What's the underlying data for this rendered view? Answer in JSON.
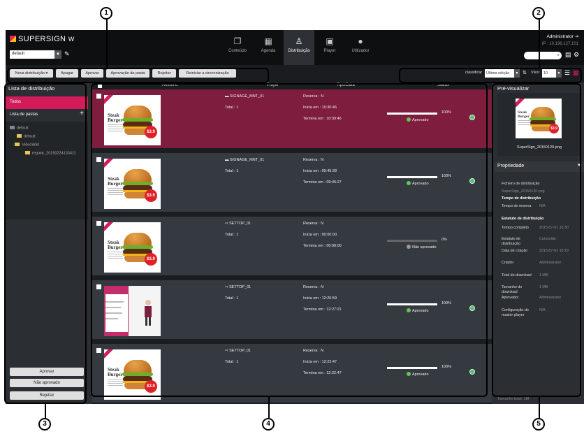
{
  "app": {
    "logo": "SUPERSIGN",
    "logo_suffix": "W",
    "group_select": "default",
    "admin_label": "Administrator",
    "ip": "IP : 10.196.127.101",
    "search_icon": "search-icon"
  },
  "nav": [
    {
      "label": "Conteúdo",
      "icon": "content-icon"
    },
    {
      "label": "Agenda",
      "icon": "calendar-icon"
    },
    {
      "label": "Distribuição",
      "icon": "distribution-icon",
      "active": true
    },
    {
      "label": "Player",
      "icon": "player-icon"
    },
    {
      "label": "Utilizador",
      "icon": "user-icon"
    }
  ],
  "toolbar": {
    "new_distribution": "Nova distribuição",
    "delete": "Apagar",
    "approve": "Aprovar",
    "folder_approval": "Aprovação da pasta",
    "reject": "Rejeitar",
    "resync": "Reiniciar a sincronização",
    "sort_label": "classificar",
    "sort_value": "Última edição",
    "view_label": "Visor",
    "view_value": "10"
  },
  "sidebar": {
    "title": "Lista de distribuição",
    "all": "Todos",
    "folders_label": "Lista de pastas",
    "tree": [
      {
        "label": "default",
        "level": 0
      },
      {
        "label": "default",
        "level": 1
      },
      {
        "label": "VideoWall",
        "level": 1
      },
      {
        "label": "regular_20150224133411",
        "level": 2
      }
    ],
    "btn_approve": "Aprovar",
    "btn_not_approved": "Não aprovado",
    "btn_reject": "Rejeitar"
  },
  "table": {
    "headers": {
      "summary": "Resumo",
      "player": "Player",
      "type": "Tipo/Data",
      "status": "Status"
    },
    "rows": [
      {
        "player": "SIGNAGE_MNT_01",
        "total": "Total : 1",
        "reservation": "Reserva : N",
        "start": "Inicia em : 10:30:46",
        "end": "Termina em : 10:30:46",
        "progress": 100,
        "progress_label": "100%",
        "status": "Aprovado",
        "thumb": "burger",
        "selected": true
      },
      {
        "player": "SIGNAGE_MNT_01",
        "total": "Total : 1",
        "reservation": "Reserva : N",
        "start": "Inicia em : 09:45:28",
        "end": "Termina em : 09:45:27",
        "progress": 100,
        "progress_label": "100%",
        "status": "Aprovado",
        "thumb": "burger"
      },
      {
        "player": "SETTOP_01",
        "total": "Total : 1",
        "reservation": "Reserva : N",
        "start": "Inicia em : 00:00:00",
        "end": "Termina em : 00:00:00",
        "progress": 0,
        "progress_label": "0%",
        "status": "Não aprovado",
        "thumb": "burger"
      },
      {
        "player": "SETTOP_01",
        "total": "Total : 1",
        "reservation": "Reserva : N",
        "start": "Inicia em : 12:26:59",
        "end": "Termina em : 12:27:21",
        "progress": 100,
        "progress_label": "100%",
        "status": "Aprovado",
        "thumb": "videowall"
      },
      {
        "player": "SETTOP_01",
        "total": "Total : 1",
        "reservation": "Reserva : N",
        "start": "Inicia em : 12:22:47",
        "end": "Termina em : 12:22:47",
        "progress": 100,
        "progress_label": "100%",
        "status": "Aprovado",
        "thumb": "burger"
      }
    ],
    "thumb_title": "Steak Burger",
    "thumb_price": "$3.9"
  },
  "preview": {
    "title": "Pré-visualizar",
    "filename": "SuperSign_20150120.png",
    "prop_title": "Propriedade",
    "dist_file_label": "Ficheiro de distribuição",
    "dist_file_value": "SuperSign_20150120.png",
    "dist_time_title": "Tempo de distribuição",
    "reserve_time_label": "Tempo de reserva",
    "reserve_time_value": "N/A",
    "status_title": "Estatuto de distribuição",
    "complete_label": "Tempo completo",
    "complete_value": "2015-07-01 10:30",
    "dist_status_label": "Estatuto de distribuição",
    "dist_status_value": "Concluído",
    "created_label": "Data de criação",
    "created_value": "2015-07-01 10:29",
    "creator_label": "Criador",
    "creator_value": "Administrator",
    "download_total_label": "Total do download",
    "download_total_value": "1 MB",
    "download_size_label": "Tamanho do download",
    "download_size_value": "1 MB",
    "approver_label": "Aprovador",
    "approver_value": "Administrator",
    "master_label": "Configuração do master-player",
    "master_value": "N/A",
    "bottom_text": "Tamanho total: 1M"
  },
  "callouts": [
    "1",
    "2",
    "3",
    "4",
    "5"
  ]
}
